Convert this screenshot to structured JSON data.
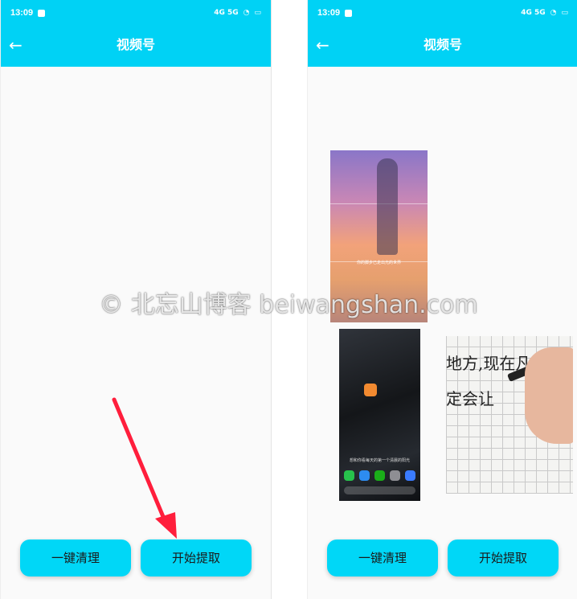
{
  "left_screen": {
    "status": {
      "time": "13:09",
      "network": "4G 5G"
    },
    "header": {
      "back_icon": "arrow-left-icon",
      "title": "视频号"
    },
    "buttons": {
      "clear_label": "一键清理",
      "start_label": "开始提取"
    }
  },
  "right_screen": {
    "status": {
      "time": "13:09",
      "network": "4G 5G"
    },
    "header": {
      "back_icon": "arrow-left-icon",
      "title": "视频号"
    },
    "thumbnails": [
      {
        "name": "anime-runner-image",
        "caption": "你的脚步已走出光的世界"
      },
      {
        "name": "phone-screenshot-image",
        "caption": "想和你看每天的第一个清晨的阳光"
      },
      {
        "name": "handwriting-image",
        "lines": [
          "地方,现在凡",
          "定会让"
        ]
      }
    ],
    "buttons": {
      "clear_label": "一键清理",
      "start_label": "开始提取"
    }
  },
  "watermark": "© 北忘山博客 beiwangshan.com",
  "colors": {
    "accent": "#00d2f5",
    "arrow": "#ff1e3c"
  }
}
